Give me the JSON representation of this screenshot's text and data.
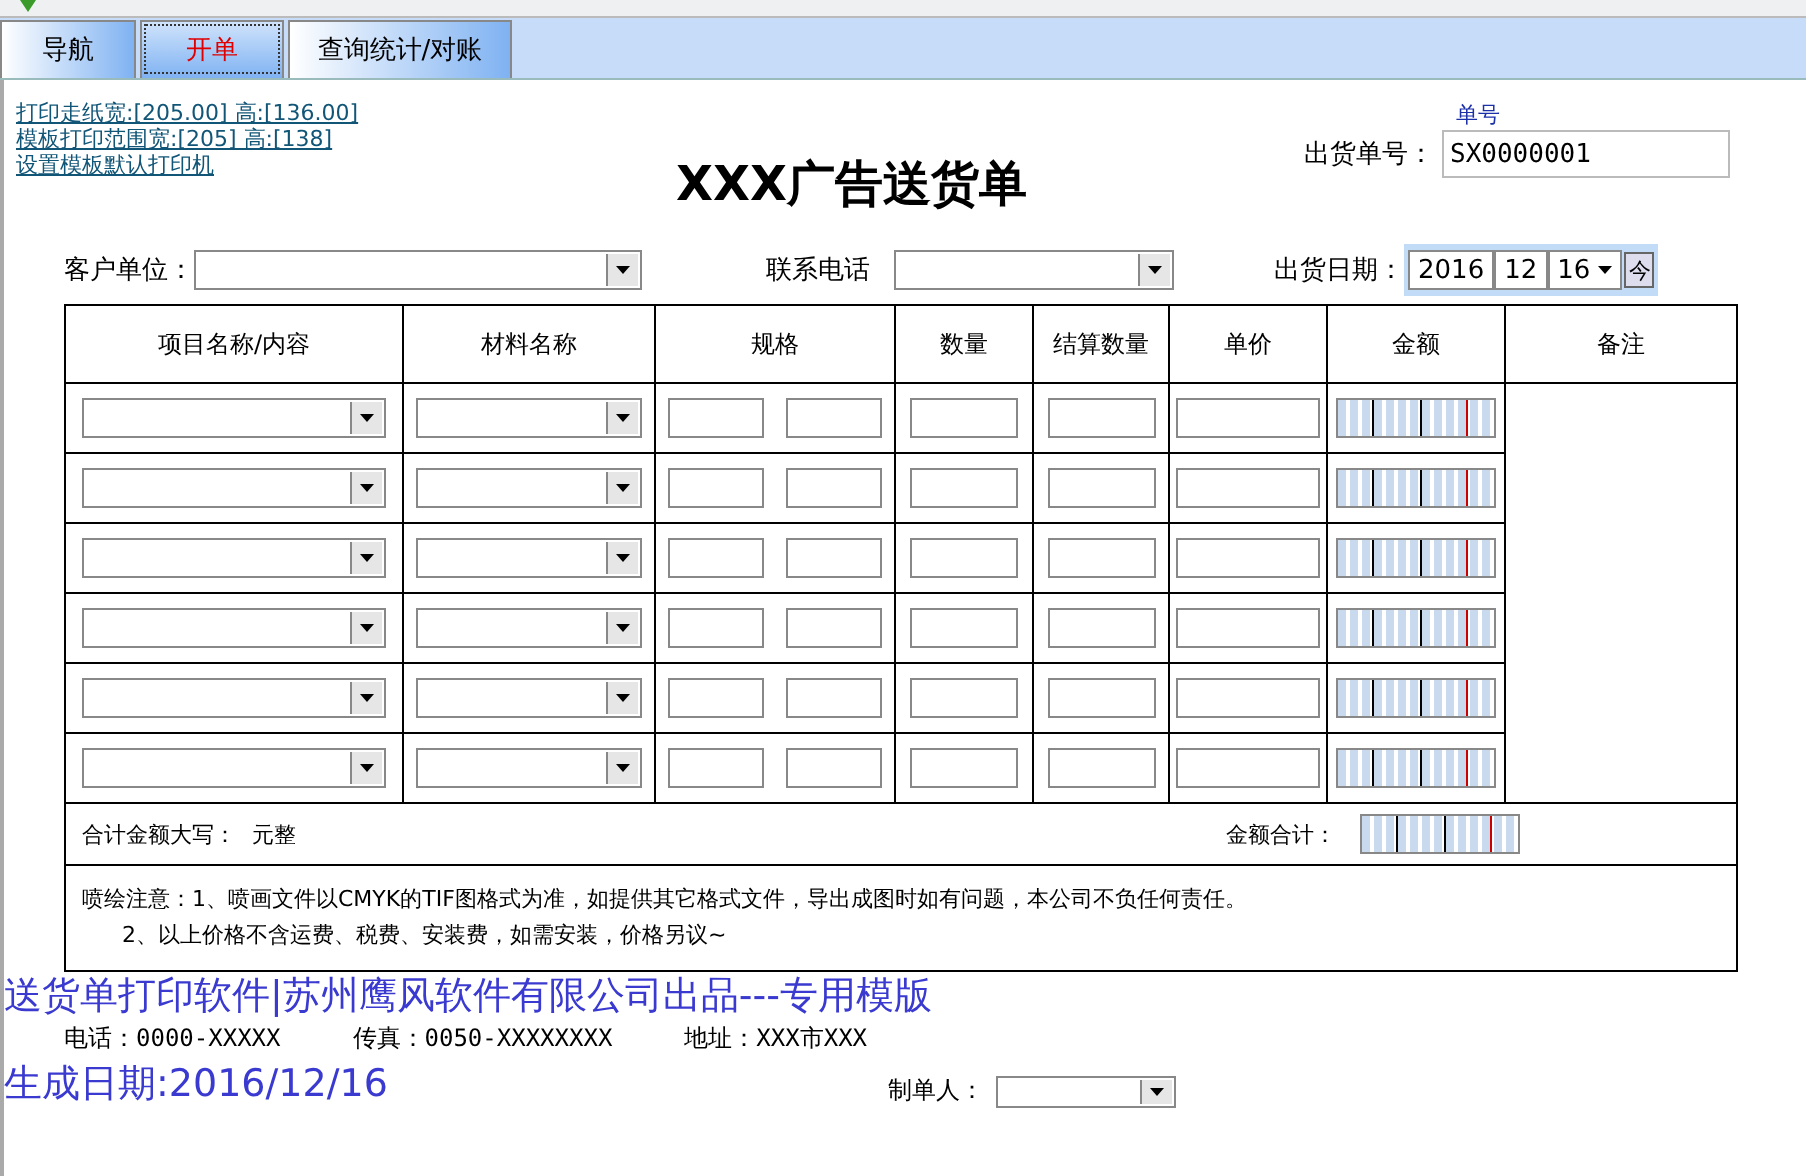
{
  "tabs": [
    {
      "label": "导航",
      "selected": false
    },
    {
      "label": "开单",
      "selected": true
    },
    {
      "label": "查询统计/对账",
      "selected": false
    }
  ],
  "print_links": [
    "打印走纸宽:[205.00] 高:[136.00]",
    "模板打印范围宽:[205] 高:[138]",
    "设置模板默认打印机"
  ],
  "title": "XXX广告送货单",
  "order_no": {
    "caption": "单号",
    "label": "出货单号：",
    "value": "SX0000001"
  },
  "customer": {
    "label": "客户单位："
  },
  "phone": {
    "label": "联系电话"
  },
  "date": {
    "label": "出货日期：",
    "year": "2016",
    "month": "12",
    "day": "16",
    "today_button": "今"
  },
  "table": {
    "columns": [
      "项目名称/内容",
      "材料名称",
      "规格",
      "数量",
      "结算数量",
      "单价",
      "金额",
      "备注"
    ]
  },
  "total": {
    "uppercase_label": "合计金额大写：",
    "uppercase_value": "元整",
    "sum_label": "金额合计："
  },
  "notes": [
    "喷绘注意：1、喷画文件以CMYK的TIF图格式为准，如提供其它格式文件，导出成图时如有问题，本公司不负任何责任。",
    "2、以上价格不含运费、税费、安装费，如需安装，价格另议~"
  ],
  "overlay": [
    "送货单打印软件|苏州鹰风软件有限公司出品---专用模版",
    "生成日期:2016/12/16"
  ],
  "contact": [
    "电话：0000-XXXXX",
    "传真：0050-XXXXXXXX",
    "地址：XXX市XXX"
  ],
  "signoff": {
    "label": "制单人："
  }
}
